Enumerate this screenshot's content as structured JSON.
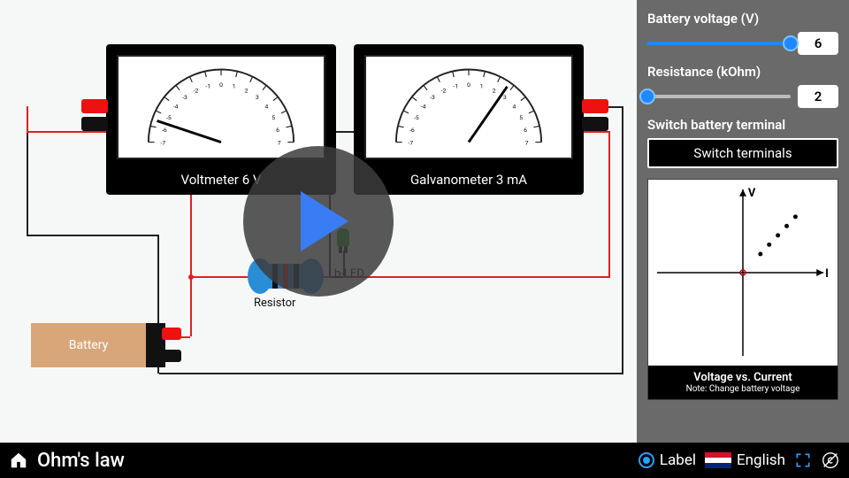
{
  "title": "Ohm's law",
  "sidebar": {
    "voltage_label": "Battery voltage (V)",
    "voltage_value": "6",
    "voltage_pct": 100,
    "resistance_label": "Resistance (kOhm)",
    "resistance_value": "2",
    "resistance_pct": 0,
    "switch_heading": "Switch battery terminal",
    "switch_button": "Switch terminals",
    "graph_title": "Voltage vs. Current",
    "graph_note": "Note: Change battery voltage",
    "graph_x_axis": "I",
    "graph_y_axis": "V"
  },
  "meters": {
    "voltmeter_label": "Voltmeter 6 V",
    "galvanometer_label": "Galvanometer 3 mA",
    "scale_ticks": [
      "-7",
      "-6",
      "-5",
      "-4",
      "-3",
      "-2",
      "-1",
      "0",
      "1",
      "2",
      "3",
      "4",
      "5",
      "6",
      "7"
    ]
  },
  "circuit": {
    "battery_label": "Battery",
    "resistor_label": "Resistor",
    "led_label": "b-LED"
  },
  "bottombar": {
    "label_toggle": "Label",
    "language": "English"
  },
  "chart_data": {
    "type": "scatter",
    "title": "Voltage vs. Current",
    "xlabel": "I",
    "ylabel": "V",
    "xlim": [
      -4,
      4
    ],
    "ylim": [
      -8,
      8
    ],
    "points": [
      {
        "x": 1.0,
        "y": 2
      },
      {
        "x": 1.5,
        "y": 3
      },
      {
        "x": 2.0,
        "y": 4
      },
      {
        "x": 2.5,
        "y": 5
      },
      {
        "x": 3.0,
        "y": 6
      }
    ]
  }
}
